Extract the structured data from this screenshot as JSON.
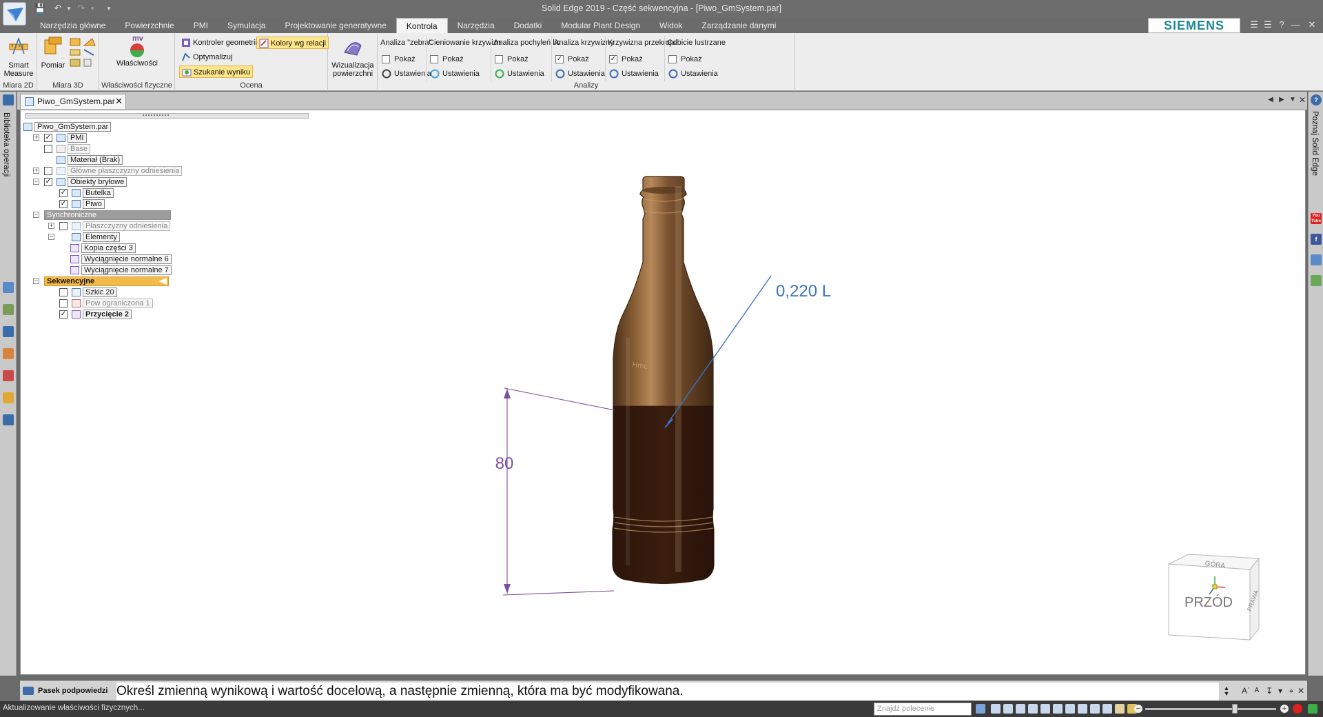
{
  "window": {
    "title": "Solid Edge 2019 - Część sekwencyjna - [Piwo_GmSystem.par]"
  },
  "ribbon_tabs": [
    {
      "label": "Narzędzia główne"
    },
    {
      "label": "Powierzchnie"
    },
    {
      "label": "PMI"
    },
    {
      "label": "Symulacja"
    },
    {
      "label": "Projektowanie generatywne"
    },
    {
      "label": "Kontrola",
      "active": true
    },
    {
      "label": "Narzędzia"
    },
    {
      "label": "Dodatki"
    },
    {
      "label": "Modular Plant Design"
    },
    {
      "label": "Widok"
    },
    {
      "label": "Zarządzanie danymi"
    }
  ],
  "brand": "SIEMENS",
  "ribbon": {
    "smart_measure": {
      "label": "Smart Measure",
      "group": "Miara 2D"
    },
    "pomiar": {
      "label": "Pomiar",
      "group": "Miara 3D"
    },
    "wlasciwosci": {
      "label": "Właściwości",
      "badge": "mv",
      "group": "Właściwości fizyczne"
    },
    "ocena": {
      "group": "Ocena",
      "kontroler": "Kontroler geometrii",
      "kolory": "Kolory wg relacji",
      "optymalizuj": "Optymalizuj",
      "szukanie": "Szukanie wyniku",
      "wizualizacja": "Wizualizacja powierzchni"
    },
    "analizy": {
      "group": "Analizy",
      "show_label": "Pokaż",
      "settings_label": "Ustawienia",
      "columns": [
        {
          "title": "Analiza \"zebra\"",
          "checked": false
        },
        {
          "title": "Cieniowanie krzywizn",
          "checked": false
        },
        {
          "title": "Analiza pochyleń lic",
          "checked": false
        },
        {
          "title": "Analiza krzywizny",
          "checked": true
        },
        {
          "title": "Krzywizna przekroju",
          "checked": true
        },
        {
          "title": "Odbicie lustrzane",
          "checked": false
        }
      ]
    }
  },
  "left_panel": {
    "label": "Biblioteka operacji"
  },
  "right_panel": {
    "label": "Poznaj Solid Edge",
    "youtube": "You Tube"
  },
  "document": {
    "tab": "Piwo_GmSystem.par"
  },
  "tree": {
    "root": "Piwo_GmSystem.par",
    "pmi": "PMI",
    "base": "Base",
    "material": "Materiał (Brak)",
    "ref_planes": "Główne płaszczyzny odniesienia",
    "bodies": "Obiekty bryłowe",
    "butelka": "Butelka",
    "piwo": "Piwo",
    "sync": "Synchroniczne",
    "sync_planes": "Płaszczyzny odniesienia",
    "elements": "Elementy",
    "kopia": "Kopia części 3",
    "wyc6": "Wyciągnięcie normalne 6",
    "wyc7": "Wyciągnięcie normalne 7",
    "seq": "Sekwencyjne",
    "szkic": "Szkic 20",
    "pow": "Pow ograniczona 1",
    "przyciecie": "Przycięcie 2"
  },
  "model": {
    "volume_label": "0,220 L",
    "dimension_value": "80",
    "liquid_fill_fraction": 0.44
  },
  "view_cube": {
    "front": "PRZÓD",
    "top": "GÓRA",
    "right": "PRAWA"
  },
  "prompt": {
    "label": "Pasek podpowiedzi",
    "text": "Określ zmienną wynikową i wartość docelową, a następnie zmienną, która ma być modyfikowana."
  },
  "status": {
    "text": "Aktualizowanie właściwości fizycznych...",
    "search_placeholder": "Znajdź polecenie"
  },
  "colors": {
    "accent_tab": "#f4f4f4",
    "highlight": "#fde68a",
    "sequential": "#f3b94a",
    "annotation_blue": "#3a74c4",
    "dimension_purple": "#7b4fa0",
    "bottle_brown": "#6e4a2a"
  }
}
